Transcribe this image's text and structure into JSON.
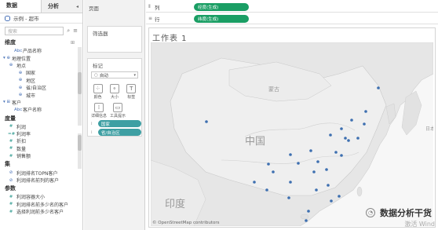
{
  "data_pane": {
    "tab_data": "数据",
    "tab_analysis": "分析",
    "datasource": "示例 - 超市",
    "search_placeholder": "搜索",
    "dimensions_title": "维度",
    "dimensions": [
      {
        "label": "产品名称",
        "indent": 18,
        "icon": "Abc"
      },
      {
        "label": "地理位置",
        "indent": 4,
        "icon": "▾ ⊕"
      },
      {
        "label": "地点",
        "indent": 10,
        "icon": "⊕"
      },
      {
        "label": "国家",
        "indent": 22,
        "icon": "⊕"
      },
      {
        "label": "地区",
        "indent": 22,
        "icon": "⊕"
      },
      {
        "label": "省/自治区",
        "indent": 22,
        "icon": "⊕"
      },
      {
        "label": "城市",
        "indent": 22,
        "icon": "⊕"
      },
      {
        "label": "客户",
        "indent": 4,
        "icon": "▾ ⊞"
      },
      {
        "label": "客户名称",
        "indent": 18,
        "icon": "Abc"
      }
    ],
    "measures_title": "度量",
    "measures": [
      {
        "label": "利润",
        "icon": "#"
      },
      {
        "label": "利润率",
        "icon": "=#"
      },
      {
        "label": "折扣",
        "icon": "#"
      },
      {
        "label": "数量",
        "icon": "#"
      },
      {
        "label": "销售额",
        "icon": "#"
      }
    ],
    "sets_title": "集",
    "sets": [
      {
        "label": "利润排名TOPN客户",
        "icon": "⊘"
      },
      {
        "label": "利润排名前列的客户",
        "icon": "⊘"
      }
    ],
    "params_title": "参数",
    "params": [
      {
        "label": "利润容器大小",
        "icon": "#"
      },
      {
        "label": "利润排名前多少名的客户",
        "icon": "#"
      },
      {
        "label": "选择利润前多少名客户",
        "icon": "#"
      }
    ]
  },
  "shelves": {
    "pages": "页面",
    "filters": "筛选器",
    "marks": "标记",
    "mark_type": "自动",
    "mark_buttons": [
      {
        "label": "颜色",
        "icon": "⁘"
      },
      {
        "label": "大小",
        "icon": "⚬"
      },
      {
        "label": "标签",
        "icon": "T"
      }
    ],
    "mark_buttons_2": [
      {
        "label": "详细信息",
        "icon": "⁞"
      },
      {
        "label": "工具提示",
        "icon": "▭"
      }
    ],
    "mark_pills": [
      "国家",
      "省/自治区"
    ]
  },
  "view": {
    "columns_label": "列",
    "rows_label": "行",
    "columns_pill": "经度(生成)",
    "rows_pill": "纬度(生成)",
    "sheet_title": "工作表 1",
    "map_labels": [
      {
        "text": "蒙古",
        "size": 7
      },
      {
        "text": "中国",
        "size": 13
      },
      {
        "text": "印度",
        "size": 13
      },
      {
        "text": "日本",
        "size": 6
      }
    ],
    "attribution": "© OpenStreetMap contributors",
    "watermark": "数据分析干货",
    "activate": "激活 Wind"
  },
  "colors": {
    "green_pill": "#1a9e64",
    "teal_pill": "#3e9fa3",
    "point": "#3d6fb0",
    "land": "#e6e6e6",
    "sea": "#ffffff"
  }
}
